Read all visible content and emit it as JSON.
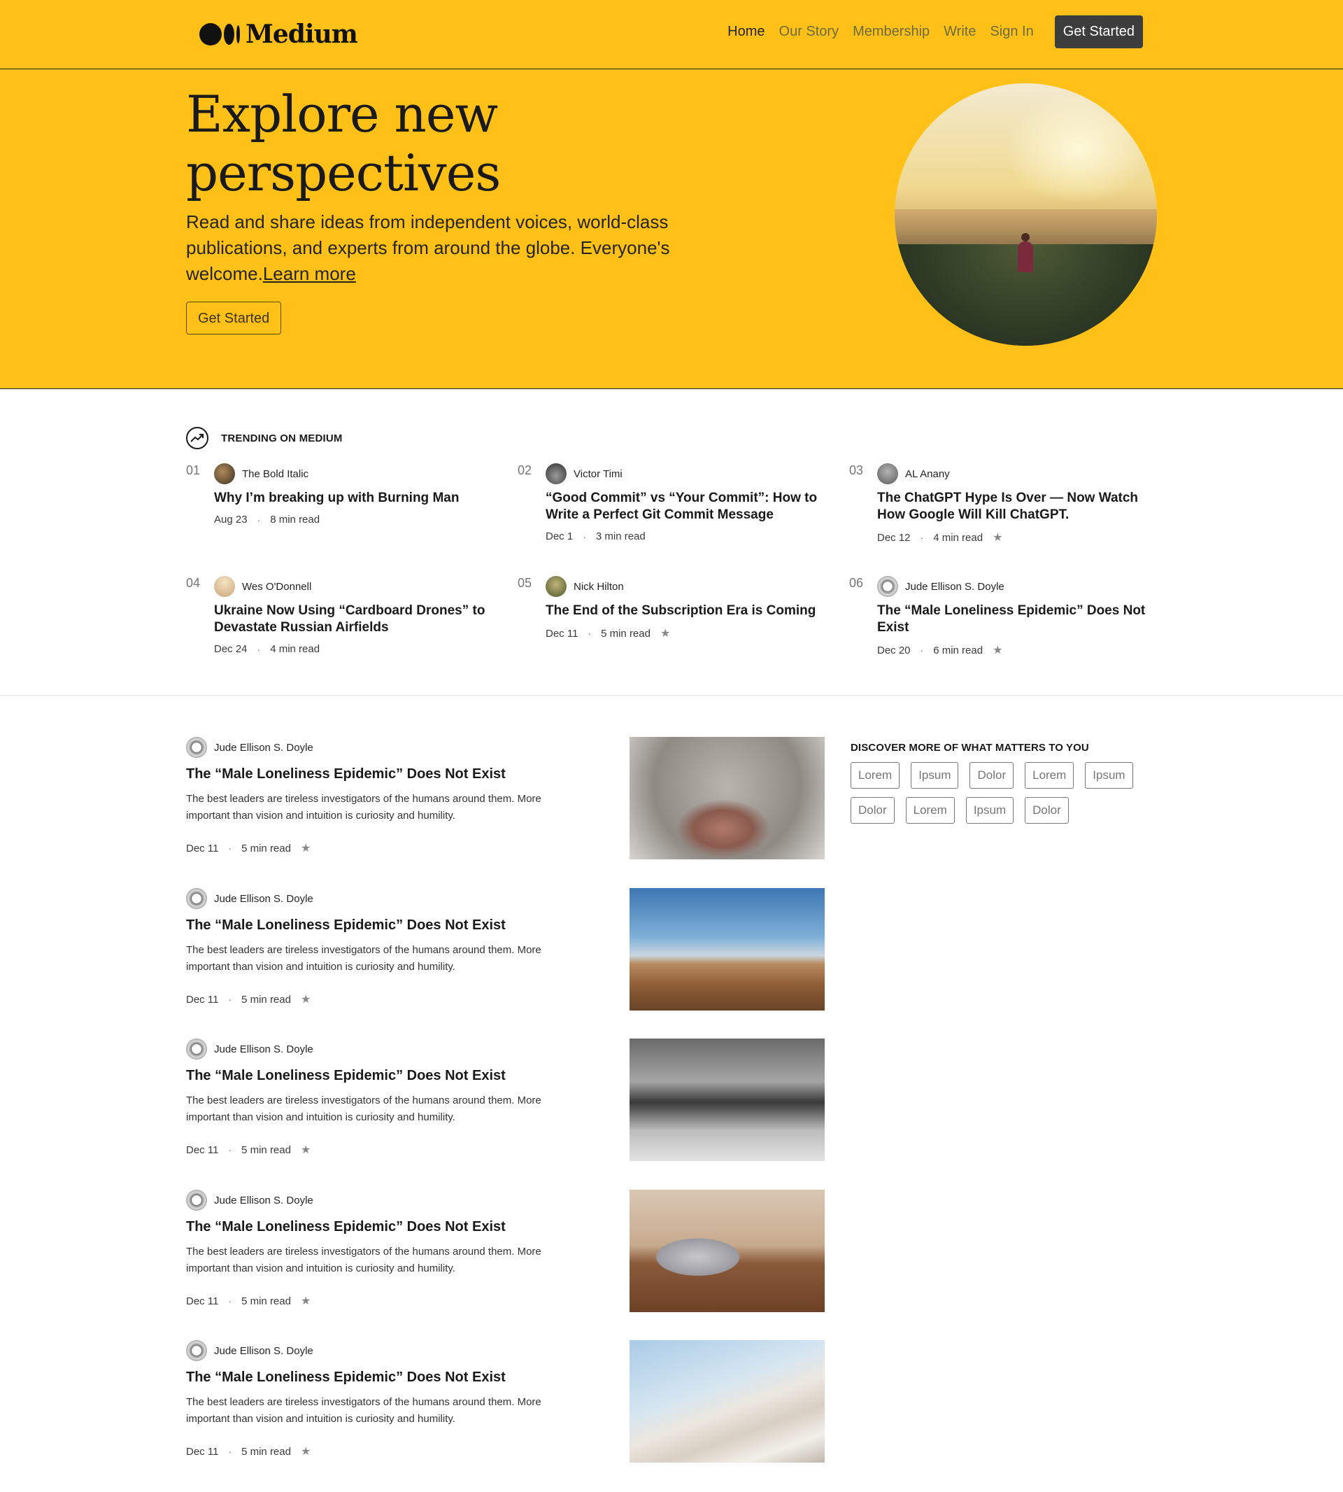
{
  "brand": {
    "name": "Medium"
  },
  "nav": {
    "items": [
      {
        "label": "Home"
      },
      {
        "label": "Our Story"
      },
      {
        "label": "Membership"
      },
      {
        "label": "Write"
      },
      {
        "label": "Sign In"
      }
    ],
    "cta_label": "Get Started"
  },
  "hero": {
    "title": "Explore new perspectives",
    "subtitle": "Read and share ideas from independent voices, world-class publications, and experts from around the globe. Everyone's welcome.",
    "learn_more": "Learn more",
    "cta_label": "Get Started"
  },
  "trending": {
    "heading": "TRENDING ON MEDIUM",
    "items": [
      {
        "num": "01",
        "author": "The Bold Italic",
        "title": "Why I’m breaking up with Burning Man",
        "date": "Aug 23",
        "read": "8 min read",
        "starred": false
      },
      {
        "num": "02",
        "author": "Victor Timi",
        "title": "“Good Commit” vs “Your Commit”: How to Write a Perfect Git Commit Message",
        "date": "Dec 1",
        "read": "3 min read",
        "starred": false
      },
      {
        "num": "03",
        "author": "AL Anany",
        "title": "The ChatGPT Hype Is Over — Now Watch How Google Will Kill ChatGPT.",
        "date": "Dec 12",
        "read": "4 min read",
        "starred": true
      },
      {
        "num": "04",
        "author": "Wes O'Donnell",
        "title": "Ukraine Now Using “Cardboard Drones” to Devastate Russian Airfields",
        "date": "Dec 24",
        "read": "4 min read",
        "starred": false
      },
      {
        "num": "05",
        "author": "Nick Hilton",
        "title": "The End of the Subscription Era is Coming",
        "date": "Dec 11",
        "read": "5 min read",
        "starred": true
      },
      {
        "num": "06",
        "author": "Jude Ellison S. Doyle",
        "title": "The “Male Loneliness Epidemic” Does Not Exist",
        "date": "Dec 20",
        "read": "6 min read",
        "starred": true
      }
    ]
  },
  "feed": {
    "posts": [
      {
        "author": "Jude Ellison S. Doyle",
        "title": "The “Male Loneliness Epidemic” Does Not Exist",
        "desc": "The best leaders are tireless investigators of the humans around them. More important than vision and intuition is curiosity and humility.",
        "date": "Dec 11",
        "read": "5 min read"
      },
      {
        "author": "Jude Ellison S. Doyle",
        "title": "The “Male Loneliness Epidemic” Does Not Exist",
        "desc": "The best leaders are tireless investigators of the humans around them. More important than vision and intuition is curiosity and humility.",
        "date": "Dec 11",
        "read": "5 min read"
      },
      {
        "author": "Jude Ellison S. Doyle",
        "title": "The “Male Loneliness Epidemic” Does Not Exist",
        "desc": "The best leaders are tireless investigators of the humans around them. More important than vision and intuition is curiosity and humility.",
        "date": "Dec 11",
        "read": "5 min read"
      },
      {
        "author": "Jude Ellison S. Doyle",
        "title": "The “Male Loneliness Epidemic” Does Not Exist",
        "desc": "The best leaders are tireless investigators of the humans around them. More important than vision and intuition is curiosity and humility.",
        "date": "Dec 11",
        "read": "5 min read"
      },
      {
        "author": "Jude Ellison S. Doyle",
        "title": "The “Male Loneliness Epidemic” Does Not Exist",
        "desc": "The best leaders are tireless investigators of the humans around them. More important than vision and intuition is curiosity and humility.",
        "date": "Dec 11",
        "read": "5 min read"
      }
    ]
  },
  "discover": {
    "heading": "DISCOVER MORE OF WHAT MATTERS TO YOU",
    "tags": [
      "Lorem",
      "Ipsum",
      "Dolor",
      "Lorem",
      "Ipsum",
      "Dolor",
      "Lorem",
      "Ipsum",
      "Dolor"
    ]
  },
  "icons": {
    "trending": "trending-up-icon",
    "bookmark": "star-icon"
  },
  "colors": {
    "accent": "#ffc017",
    "dark_button": "#3d3d3d"
  }
}
